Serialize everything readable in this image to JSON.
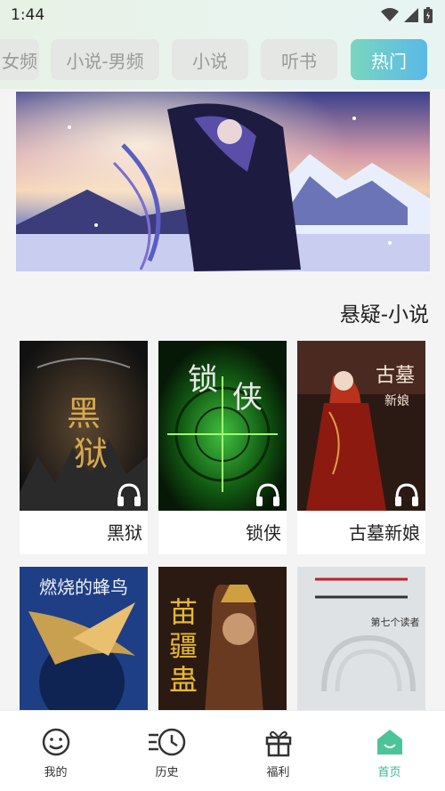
{
  "status": {
    "time": "1:44"
  },
  "tabs": [
    {
      "label": "女频"
    },
    {
      "label": "小说-男频"
    },
    {
      "label": "小说"
    },
    {
      "label": "听书"
    },
    {
      "label": "热门"
    }
  ],
  "section": {
    "title": "悬疑-小说"
  },
  "books": [
    {
      "title": "黑狱",
      "cover_text": "黑狱",
      "audio": true
    },
    {
      "title": "锁侠",
      "cover_text": "锁侠",
      "audio": true
    },
    {
      "title": "古墓新娘",
      "cover_text": "古墓新娘",
      "audio": true
    }
  ],
  "books_row2": [
    {
      "cover_text": "燃烧的蜂鸟"
    },
    {
      "cover_text": "苗疆蛊事"
    },
    {
      "cover_text": "第七个读者"
    }
  ],
  "nav": [
    {
      "label": "我的",
      "icon": "face-icon"
    },
    {
      "label": "历史",
      "icon": "history-icon"
    },
    {
      "label": "福利",
      "icon": "gift-icon"
    },
    {
      "label": "首页",
      "icon": "home-icon"
    }
  ],
  "colors": {
    "accent": "#3ab88e",
    "tab_gradient_start": "#79d6bf",
    "tab_gradient_end": "#59b9e8"
  }
}
